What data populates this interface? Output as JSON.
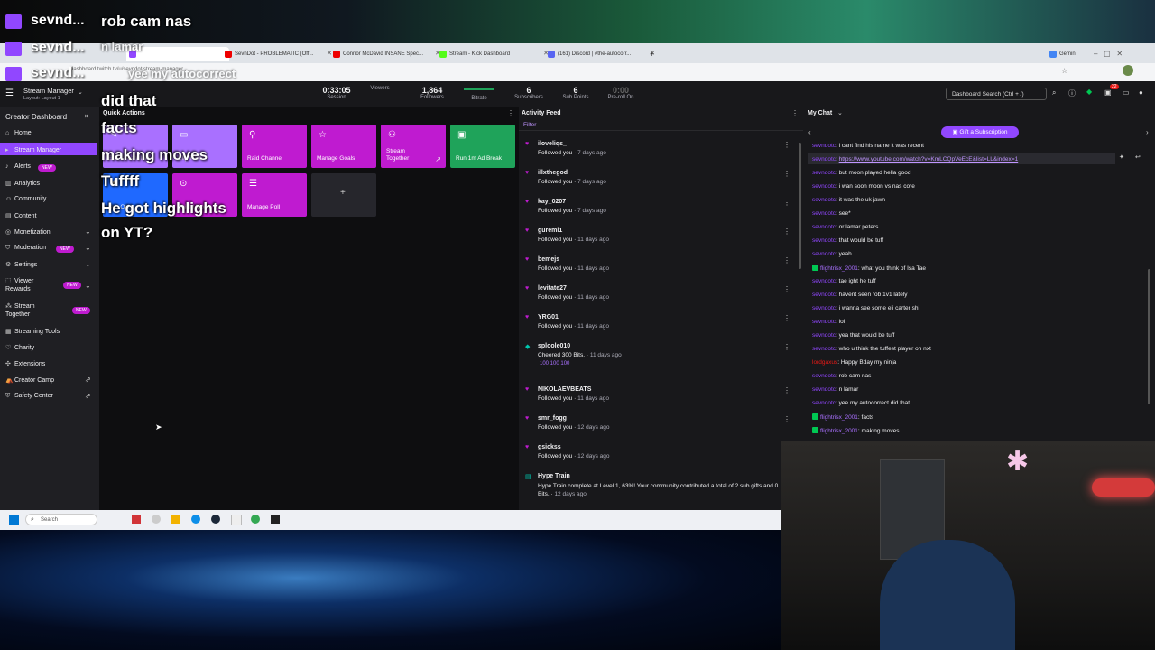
{
  "overlay_chat": {
    "username": "sevnd...",
    "lines": [
      "rob cam nas",
      "n lamar",
      "yee my autocorrect",
      "did that",
      "facts",
      "making moves",
      "Tuffff",
      "He got highlights",
      "on YT?"
    ]
  },
  "browser": {
    "tabs": [
      {
        "label": "SevnDot - PROBLEMATIC (Off..."
      },
      {
        "label": "Connor McDavid INSANE Spec..."
      },
      {
        "label": "Stream - Kick Dashboard"
      },
      {
        "label": "(161) Discord | #the-autocorr..."
      }
    ],
    "profile_label": "Gemini",
    "url": "dashboard.twitch.tv/u/sevndot/stream-manager"
  },
  "header": {
    "title": "Stream Manager",
    "layout": "Layout: Layout 1",
    "stats": [
      {
        "value": "0:33:05",
        "label": "Session"
      },
      {
        "value": "",
        "label": "Viewers"
      },
      {
        "value": "1,864",
        "label": "Followers"
      },
      {
        "value": "",
        "label": "Bitrate"
      },
      {
        "value": "6",
        "label": "Subscribers"
      },
      {
        "value": "6",
        "label": "Sub Points"
      },
      {
        "value": "0:00",
        "label": "Pre-roll On"
      }
    ],
    "search_placeholder": "Dashboard Search (Ctrl + /)",
    "notif_count": "22"
  },
  "sidebar": {
    "title": "Creator Dashboard",
    "items": [
      {
        "label": "Home"
      },
      {
        "label": "Stream Manager"
      },
      {
        "label": "Alerts"
      },
      {
        "label": "Analytics"
      },
      {
        "label": "Community"
      },
      {
        "label": "Content"
      },
      {
        "label": "Monetization"
      },
      {
        "label": "Moderation"
      },
      {
        "label": "Settings"
      },
      {
        "label": "Viewer Rewards"
      },
      {
        "label": "Stream Together"
      },
      {
        "label": "Streaming Tools"
      },
      {
        "label": "Charity"
      },
      {
        "label": "Extensions"
      },
      {
        "label": "Creator Camp"
      },
      {
        "label": "Safety Center"
      }
    ],
    "new_label": "NEW"
  },
  "quick_actions": {
    "title": "Quick Actions",
    "tiles": [
      {
        "label": "Edit Stream Info"
      },
      {
        "label": "Clip That"
      },
      {
        "label": "Raid Channel"
      },
      {
        "label": "Manage Goals"
      },
      {
        "label": "Stream Together"
      },
      {
        "label": "Run 1m Ad Break"
      },
      {
        "label": "Sub Only"
      },
      {
        "label": "Shield Mode"
      },
      {
        "label": "Manage Poll"
      }
    ],
    "add_label": "+"
  },
  "activity_feed": {
    "title": "Activity Feed",
    "filter": "Filter",
    "items": [
      {
        "name": "iloveliqs_",
        "sub": "Followed you",
        "time": "7 days ago"
      },
      {
        "name": "illxthegod",
        "sub": "Followed you",
        "time": "7 days ago"
      },
      {
        "name": "kay_0207",
        "sub": "Followed you",
        "time": "7 days ago"
      },
      {
        "name": "guremi1",
        "sub": "Followed you",
        "time": "11 days ago"
      },
      {
        "name": "bemejs",
        "sub": "Followed you",
        "time": "11 days ago"
      },
      {
        "name": "levitate27",
        "sub": "Followed you",
        "time": "11 days ago"
      },
      {
        "name": "YRG01",
        "sub": "Followed you",
        "time": "11 days ago"
      },
      {
        "name": "sploole010",
        "sub": "Cheered 300 Bits.",
        "time": "11 days ago",
        "cheer": "100 100 100"
      },
      {
        "name": "NIKOLAEVBEATS",
        "sub": "Followed you",
        "time": "11 days ago"
      },
      {
        "name": "smr_fogg",
        "sub": "Followed you",
        "time": "12 days ago"
      },
      {
        "name": "gsickss",
        "sub": "Followed you",
        "time": "12 days ago"
      },
      {
        "name": "Hype Train",
        "sub": "Hype Train complete at Level 1, 63%! Your community contributed a total of 2 sub gifts and 0 Bits.",
        "time": "12 days ago"
      }
    ]
  },
  "chat": {
    "title": "My Chat",
    "gift_button": "Gift a Subscription",
    "messages": [
      {
        "user": "sevndotc",
        "text": "i cant find his name it was recent"
      },
      {
        "user": "sevndotc",
        "text": "https://www.youtube.com/watch?v=KmLCQpVeEcE&list=LL&index=1"
      },
      {
        "user": "sevndotc",
        "text": "but moon played hella good"
      },
      {
        "user": "sevndotc",
        "text": "i wan soon moon vs nas core"
      },
      {
        "user": "sevndotc",
        "text": "it was the uk jawn"
      },
      {
        "user": "sevndotc",
        "text": "see*"
      },
      {
        "user": "sevndotc",
        "text": "or lamar peters"
      },
      {
        "user": "sevndotc",
        "text": "that would be tuff"
      },
      {
        "user": "sevndotc",
        "text": "yeah"
      },
      {
        "user": "flightrisx_2001",
        "text": "what you think of Isa Tae",
        "badge": true
      },
      {
        "user": "sevndotc",
        "text": "tae ight he tuff"
      },
      {
        "user": "sevndotc",
        "text": "havent seen rob 1v1 lately"
      },
      {
        "user": "sevndotc",
        "text": "i wanna see some eli carter shi"
      },
      {
        "user": "sevndotc",
        "text": "lol"
      },
      {
        "user": "sevndotc",
        "text": "yea that would be tuff"
      },
      {
        "user": "sevndotc",
        "text": "who u think the tuffest player on nxt"
      },
      {
        "user": "lordgaxus",
        "text": "Happy Bday my ninja",
        "red": true
      },
      {
        "user": "sevndotc",
        "text": "rob cam nas"
      },
      {
        "user": "sevndotc",
        "text": "n lamar"
      },
      {
        "user": "sevndotc",
        "text": "yee my autocorrect did that"
      },
      {
        "user": "flightrisx_2001",
        "text": "facts",
        "badge": true
      },
      {
        "user": "flightrisx_2001",
        "text": "making moves",
        "badge": true
      }
    ]
  },
  "taskbar": {
    "search_label": "Search"
  },
  "colors": {
    "twitch_purple": "#9147ff",
    "tile_purple": "#a970ff",
    "tile_magenta": "#bf1bd0",
    "tile_green": "#1fa35a",
    "tile_blue": "#1f69ff",
    "tile_gray": "#26262c"
  }
}
